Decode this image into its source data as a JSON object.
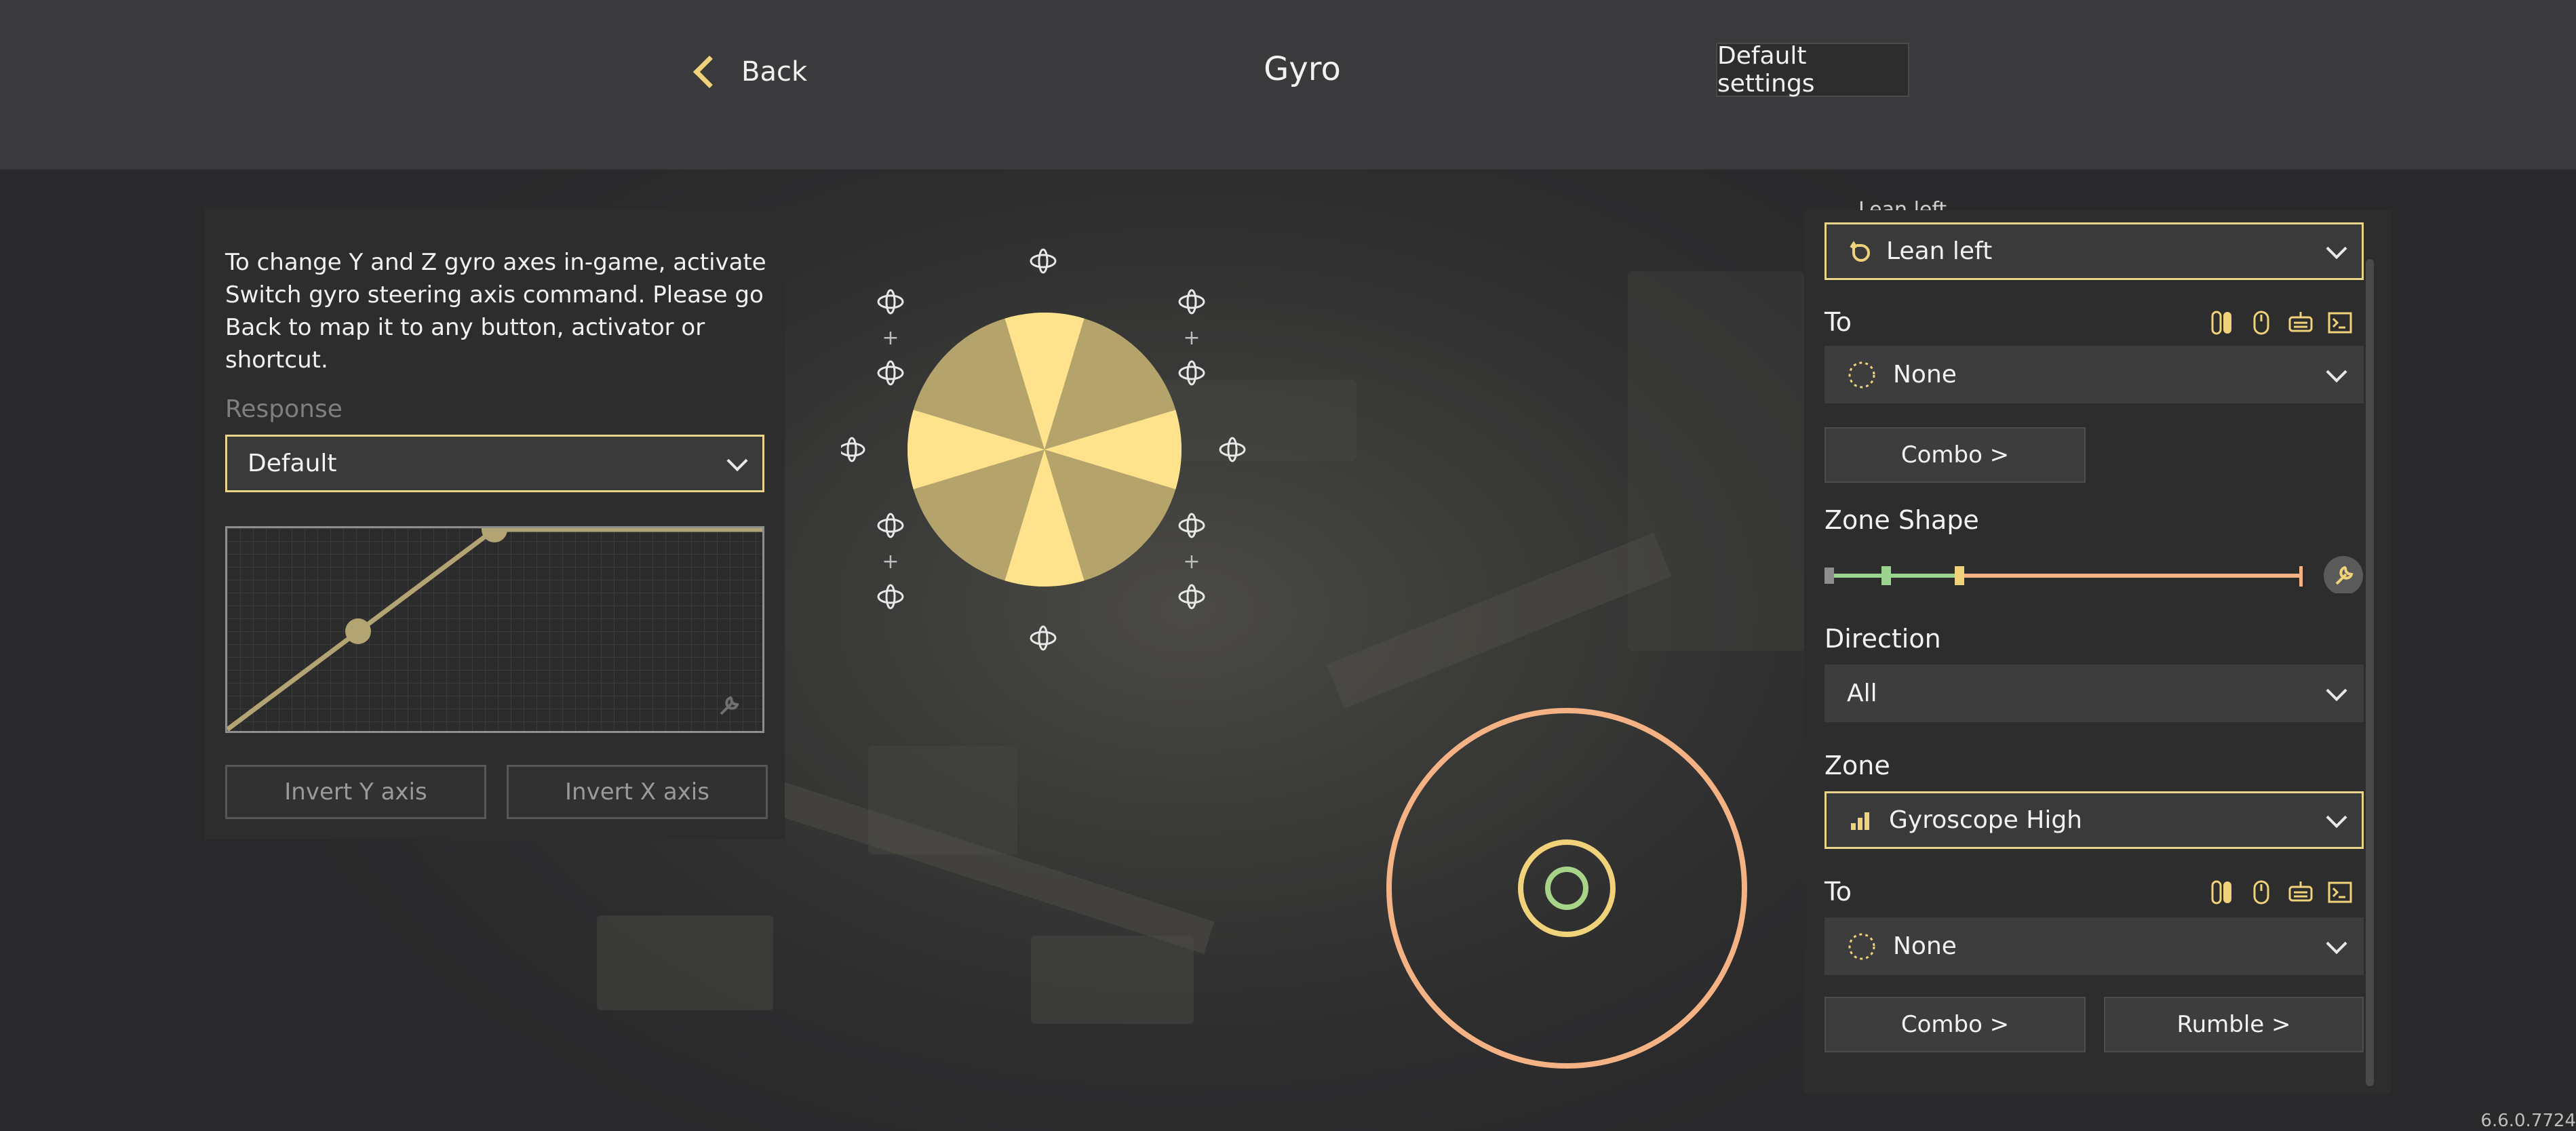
{
  "header": {
    "back_label": "Back",
    "title": "Gyro",
    "default_settings_label": "Default settings"
  },
  "left_panel": {
    "info_text": "To change Y and Z gyro axes in-game, activate Switch gyro steering axis command. Please go Back to map it to any button, activator or shortcut.",
    "response_label": "Response",
    "response_value": "Default",
    "invert_y_label": "Invert Y axis",
    "invert_x_label": "Invert X axis"
  },
  "right_panel": {
    "action_value": "Lean left",
    "to_label_1": "To",
    "to_value_1": "None",
    "combo_label_1": "Combo >",
    "zone_shape_label": "Zone Shape",
    "direction_label": "Direction",
    "direction_value": "All",
    "zone_label": "Zone",
    "zone_value": "Gyroscope High",
    "to_label_2": "To",
    "to_value_2": "None",
    "combo_label_2": "Combo >",
    "rumble_label": "Rumble >",
    "clipped_title": "Lean left"
  },
  "version": "6.6.0.7724",
  "colors": {
    "accent": "#f0d27a",
    "zone_ring": "#f5b285",
    "inner_ring": "#f0d27a",
    "core_ring": "#a8d48a",
    "slider_green": "#9bd48e",
    "slider_orange": "#f5b285"
  },
  "icons": {
    "back": "chevron-left-icon",
    "lean": "rotate-ccw-icon",
    "none": "dashed-circle-icon",
    "zone": "signal-bars-icon",
    "binding_icons": [
      "switch-controller-icon",
      "mouse-icon",
      "gamepad-icon",
      "terminal-icon"
    ],
    "wrench": "wrench-icon"
  }
}
